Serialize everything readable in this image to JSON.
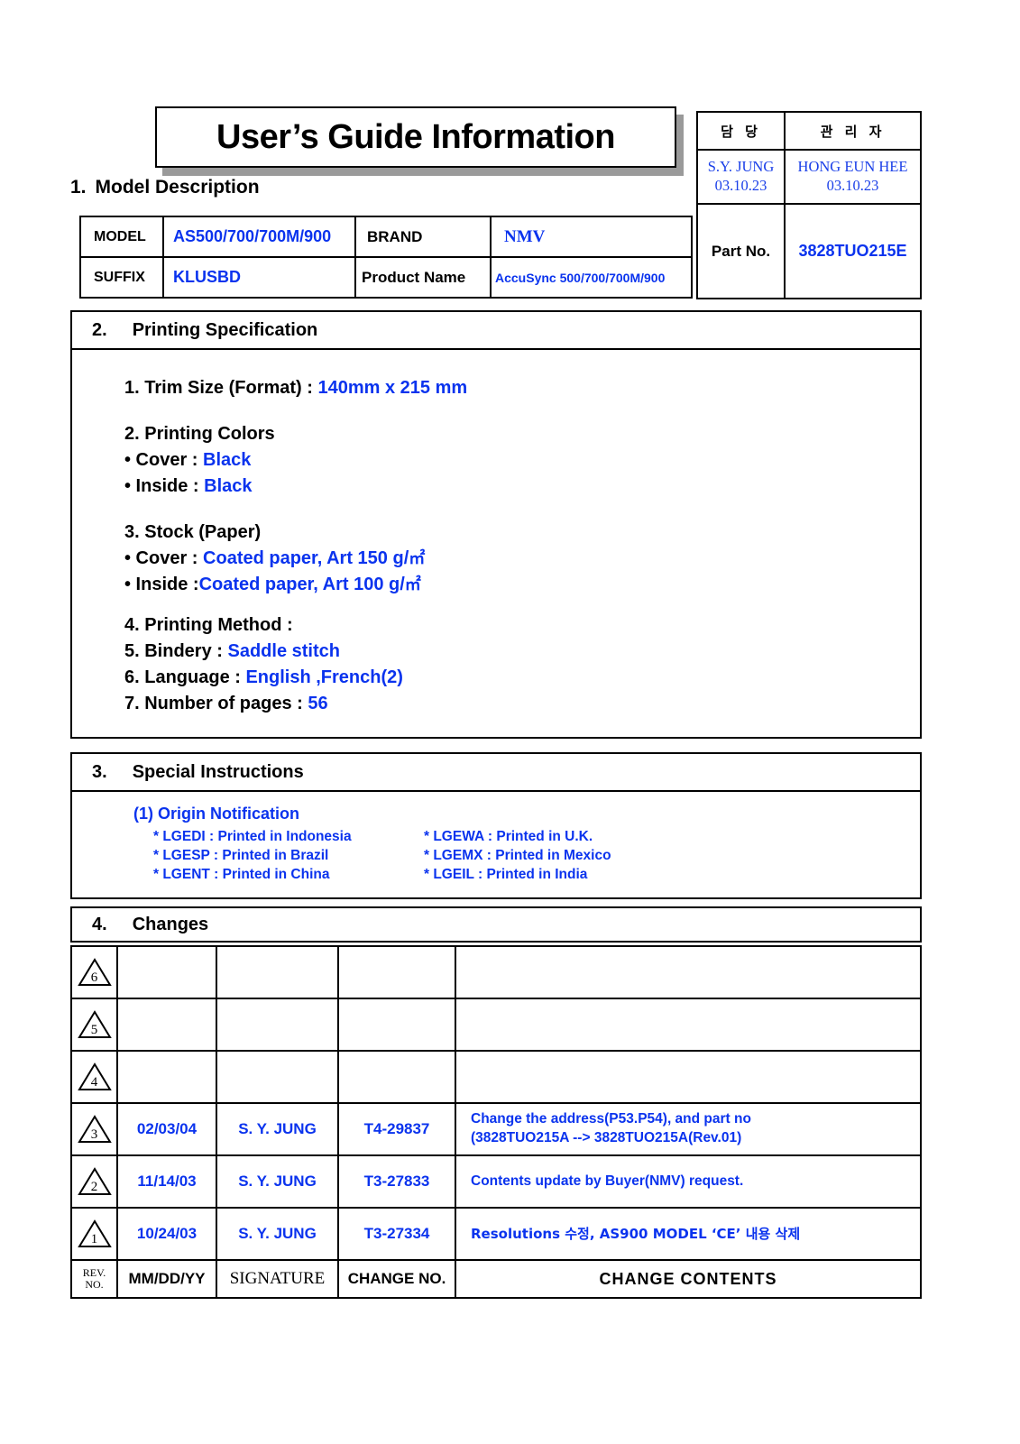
{
  "document": {
    "title": "User’s Guide Information"
  },
  "approval": {
    "col1_header": "담 당",
    "col2_header": "관 리 자",
    "col1_name": "S.Y. JUNG",
    "col1_date": "03.10.23",
    "col2_name": "HONG EUN HEE",
    "col2_date": "03.10.23",
    "part_label": "Part No.",
    "part_value": "3828TUO215E"
  },
  "section1": {
    "number": "1.",
    "title": "Model Description",
    "model_label": "MODEL",
    "model_value": "AS500/700/700M/900",
    "suffix_label": "SUFFIX",
    "suffix_value": "KLUSBD",
    "brand_label": "BRAND",
    "brand_value": "NMV",
    "product_label": "Product Name",
    "product_value": "AccuSync 500/700/700M/900"
  },
  "section2": {
    "number": "2.",
    "title": "Printing Specification",
    "trim_label": "1. Trim Size (Format) :",
    "trim_value": "140mm x 215 mm",
    "colors_label": "2. Printing Colors",
    "colors_cover_label": "• Cover :",
    "colors_cover_value": "Black",
    "colors_inside_label": "• Inside :",
    "colors_inside_value": "Black",
    "stock_label": "3. Stock (Paper)",
    "stock_cover_label": "• Cover :",
    "stock_cover_value": "Coated paper, Art 150 g/",
    "stock_cover_unit": "㎡",
    "stock_inside_label": "• Inside :",
    "stock_inside_value": "Coated paper, Art 100 g/",
    "stock_inside_unit": "㎡",
    "method_label": "4. Printing Method :",
    "method_value": "",
    "bindery_label": "5. Bindery  :",
    "bindery_value": "Saddle stitch",
    "language_label": "6. Language :",
    "language_value": "English ,French(2)",
    "pages_label": "7. Number of pages :",
    "pages_value": "56"
  },
  "section3": {
    "number": "3.",
    "title": "Special Instructions",
    "origin_title": "(1) Origin Notification",
    "origin_items": [
      "* LGEDI : Printed in Indonesia",
      "* LGEWA : Printed in U.K.",
      "* LGESP : Printed in Brazil",
      "* LGEMX : Printed in Mexico",
      "* LGENT : Printed in China",
      "* LGEIL : Printed in India"
    ]
  },
  "section4": {
    "number": "4.",
    "title": "Changes",
    "rows": [
      {
        "rev": "6",
        "date": "",
        "signature": "",
        "change_no": "",
        "contents_line1": "",
        "contents_line2": ""
      },
      {
        "rev": "5",
        "date": "",
        "signature": "",
        "change_no": "",
        "contents_line1": "",
        "contents_line2": ""
      },
      {
        "rev": "4",
        "date": "",
        "signature": "",
        "change_no": "",
        "contents_line1": "",
        "contents_line2": ""
      },
      {
        "rev": "3",
        "date": "02/03/04",
        "signature": "S. Y. JUNG",
        "change_no": "T4-29837",
        "contents_line1": "Change the address(P53.P54), and part no",
        "contents_line2": "(3828TUO215A --> 3828TUO215A(Rev.01)"
      },
      {
        "rev": "2",
        "date": "11/14/03",
        "signature": "S. Y. JUNG",
        "change_no": "T3-27833",
        "contents_line1": "Contents update by Buyer(NMV) request.",
        "contents_line2": ""
      },
      {
        "rev": "1",
        "date": "10/24/03",
        "signature": "S. Y. JUNG",
        "change_no": "T3-27334",
        "contents_line1": "Resolutions 수정,  AS900 MODEL ‘CE’ 내용 삭제",
        "contents_line2": ""
      }
    ],
    "footer": {
      "rev_line1": "REV.",
      "rev_line2": "NO.",
      "date": "MM/DD/YY",
      "signature": "SIGNATURE",
      "change_no": "CHANGE NO.",
      "contents": "CHANGE   CONTENTS"
    }
  },
  "colors": {
    "blue": "#0a33ee",
    "serif_blue": "#1a3fe8",
    "black": "#000000",
    "shadow_gray": "#9a9a9a"
  }
}
